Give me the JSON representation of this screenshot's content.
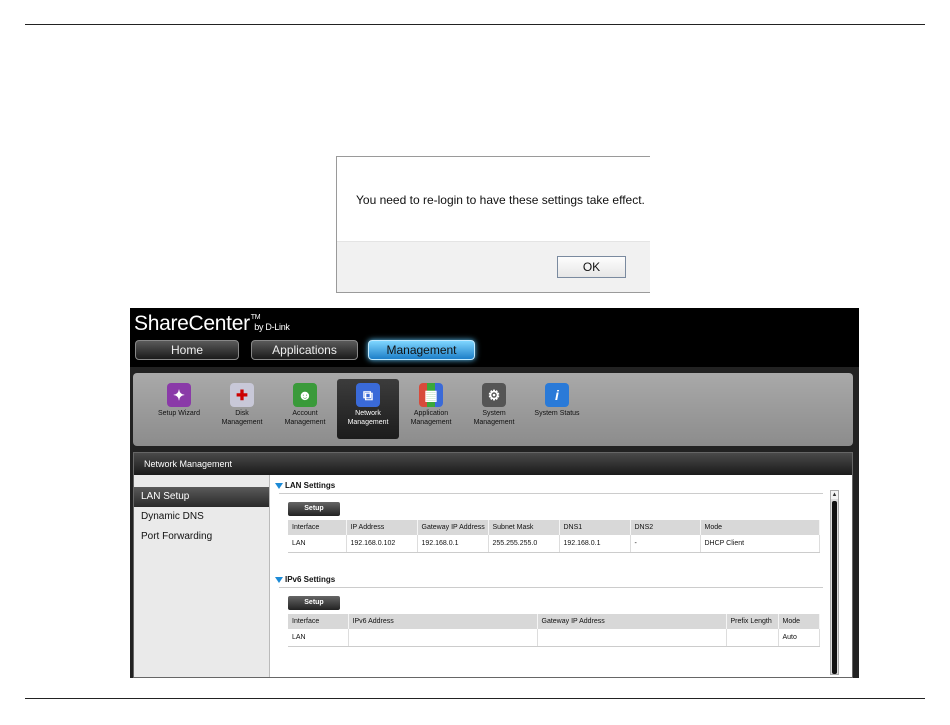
{
  "dialog": {
    "message": "You need to re-login to have these settings take effect.",
    "ok_label": "OK"
  },
  "app": {
    "logo": {
      "name": "ShareCenter",
      "tm": "TM",
      "by": "by D-Link"
    },
    "nav_tabs": [
      {
        "label": "Home"
      },
      {
        "label": "Applications"
      },
      {
        "label": "Management"
      }
    ],
    "active_tab": "Management",
    "toolbar": [
      {
        "line1": "Setup Wizard",
        "line2": "",
        "icon": "wizard-icon",
        "color": "#8a3aa8"
      },
      {
        "line1": "Disk",
        "line2": "Management",
        "icon": "disk-icon",
        "color": "#c8c8d8"
      },
      {
        "line1": "Account",
        "line2": "Management",
        "icon": "account-icon",
        "color": "#3a9a3a"
      },
      {
        "line1": "Network",
        "line2": "Management",
        "icon": "network-icon",
        "color": "#3a6ad8"
      },
      {
        "line1": "Application",
        "line2": "Management",
        "icon": "application-icon",
        "color": "#d84a3a"
      },
      {
        "line1": "System",
        "line2": "Management",
        "icon": "system-icon",
        "color": "#555555"
      },
      {
        "line1": "System Status",
        "line2": "",
        "icon": "info-icon",
        "color": "#2a7ad8"
      }
    ],
    "panel_title": "Network Management",
    "sidebar": [
      "LAN Setup",
      "Dynamic DNS",
      "Port Forwarding"
    ],
    "lan_settings": {
      "heading": "LAN Settings",
      "setup_label": "Setup",
      "columns": [
        "Interface",
        "IP Address",
        "Gateway IP Address",
        "Subnet Mask",
        "DNS1",
        "DNS2",
        "Mode"
      ],
      "rows": [
        [
          "LAN",
          "192.168.0.102",
          "192.168.0.1",
          "255.255.255.0",
          "192.168.0.1",
          "-",
          "DHCP Client"
        ]
      ]
    },
    "ipv6_settings": {
      "heading": "IPv6 Settings",
      "setup_label": "Setup",
      "columns": [
        "Interface",
        "IPv6 Address",
        "Gateway IP Address",
        "Prefix Length",
        "Mode"
      ],
      "rows": [
        [
          "LAN",
          "",
          "",
          "",
          "Auto"
        ]
      ]
    },
    "colors": {
      "accent": "#1c8ad6",
      "active_tab": "#3aaef0"
    }
  }
}
